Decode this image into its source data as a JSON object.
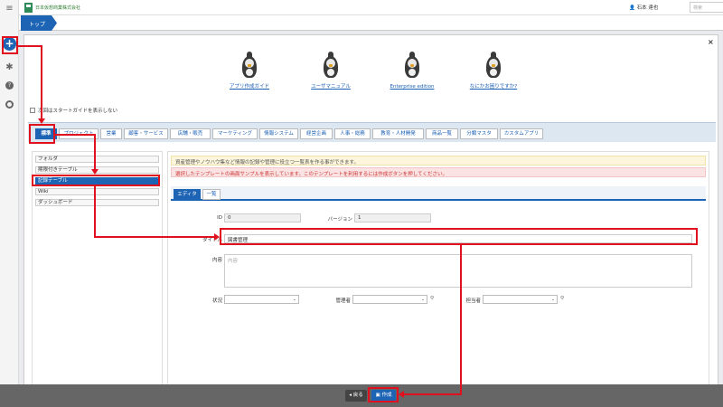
{
  "header": {
    "company": "日本仮想商業株式会社",
    "user": "石本 達也",
    "search_placeholder": "検索"
  },
  "breadcrumb": {
    "top": "トップ"
  },
  "guides": [
    {
      "label": "アプリ作成ガイド"
    },
    {
      "label": "ユーザマニュアル"
    },
    {
      "label": "Enterprise edition"
    },
    {
      "label": "なにかお困りですか?"
    }
  ],
  "start_guide_label": "次回はスタートガイドを表示しない",
  "template_tabs": [
    "標準",
    "プロジェクト",
    "営業",
    "顧客・サービス",
    "店舗・販売",
    "マーケティング",
    "情報システム",
    "経営企画",
    "人事・総務",
    "教育・人材開発",
    "商品一覧",
    "分類マスタ",
    "カスタムアプリ"
  ],
  "template_list": [
    "フォルダ",
    "期限付きテーブル",
    "記録テーブル",
    "Wiki",
    "ダッシュボード"
  ],
  "selected_template": "記録テーブル",
  "info_text": "資産管理やノウハウ集など情報の記録や管理に役立つ一覧表を作る事ができます。",
  "warn_text": "選択したテンプレートの画面サンプルを表示しています。このテンプレートを利用するには作成ボタンを押してください。",
  "editor_tabs": {
    "editor": "エディタ",
    "list": "一覧"
  },
  "form": {
    "id_label": "ID",
    "id_value": "0",
    "version_label": "バージョン",
    "version_value": "1",
    "title_label": "タイトル",
    "title_value": "図書管理",
    "content_label": "内容",
    "content_placeholder": "内容",
    "status_label": "状況",
    "manager_label": "管理者",
    "owner_label": "担当者"
  },
  "footer": {
    "back": "戻る",
    "create": "作成"
  }
}
